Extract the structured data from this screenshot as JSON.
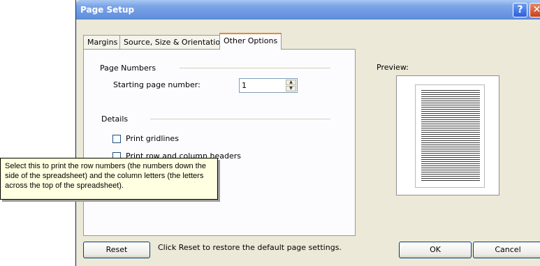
{
  "window": {
    "title": "Page Setup",
    "help_glyph": "?",
    "close_glyph": "✕"
  },
  "tabs": [
    {
      "label": "Margins"
    },
    {
      "label": "Source, Size & Orientation"
    },
    {
      "label": "Other Options",
      "active": true
    }
  ],
  "page_numbers": {
    "group_title": "Page Numbers",
    "starting_label": "Starting page number:",
    "starting_value": "1"
  },
  "details": {
    "group_title": "Details",
    "print_gridlines_label": "Print gridlines",
    "print_gridlines_checked": false,
    "print_headers_label": "Print row and column headers",
    "print_headers_checked": false
  },
  "preview": {
    "label": "Preview:"
  },
  "tooltip": {
    "text": "Select this to print the row numbers (the numbers down the side of the spreadsheet) and the column letters (the letters across the top of the spreadsheet)."
  },
  "footer": {
    "reset_label": "Reset",
    "reset_hint": "Click Reset to restore the default page settings.",
    "ok_label": "OK",
    "cancel_label": "Cancel"
  },
  "colors": {
    "title_bar": "#6b97e2",
    "tab_accent": "#e68b2c",
    "tooltip_bg": "#ffffe1"
  }
}
